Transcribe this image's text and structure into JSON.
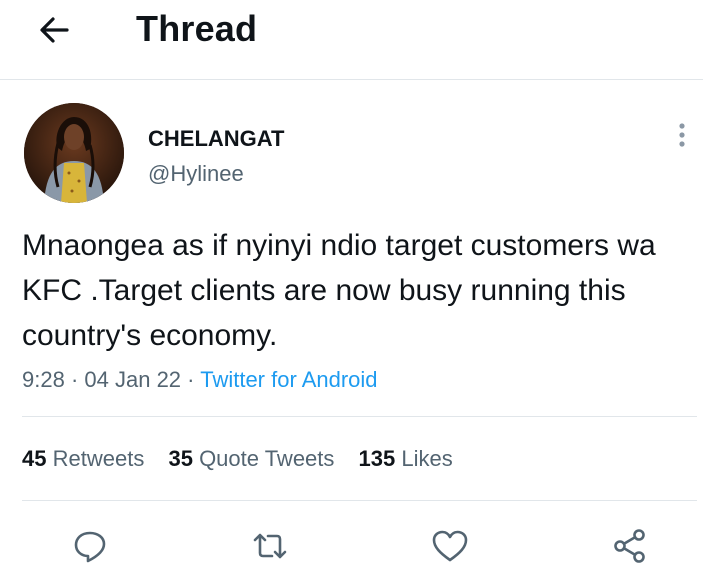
{
  "header": {
    "title": "Thread",
    "back_icon": "arrow-left-icon"
  },
  "tweet": {
    "display_name": "CHELANGAT",
    "handle": "@Hylinee",
    "text": "Mnaongea as if nyinyi ndio target customers wa KFC .Target clients are now busy running this country's economy.",
    "time": "9:28",
    "date": "04 Jan 22",
    "source": "Twitter for Android",
    "separator": "·"
  },
  "stats": {
    "retweets_count": "45",
    "retweets_label": "Retweets",
    "quotes_count": "35",
    "quotes_label": "Quote Tweets",
    "likes_count": "135",
    "likes_label": "Likes"
  },
  "actions": [
    "reply-icon",
    "retweet-icon",
    "like-icon",
    "share-icon"
  ],
  "colors": {
    "text": "#0f1419",
    "secondary": "#536471",
    "link": "#1d9bf0",
    "divider": "#e1e6ea"
  }
}
